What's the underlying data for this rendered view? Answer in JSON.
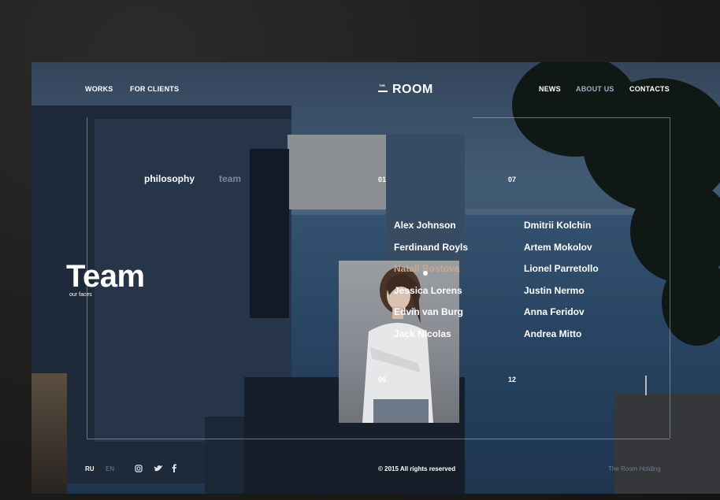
{
  "nav": {
    "left": [
      "WORKS",
      "FOR CLIENTS"
    ],
    "logo_small": "THE",
    "logo": "ROOM",
    "right": [
      {
        "label": "NEWS",
        "active": false
      },
      {
        "label": "ABOUT US",
        "active": true
      },
      {
        "label": "CONTACTS",
        "active": false
      }
    ]
  },
  "subnav": {
    "items": [
      "philosophy",
      "team"
    ],
    "active": "team"
  },
  "section": {
    "title": "Team",
    "subtitle": "our faces"
  },
  "pagination": {
    "top_left": "01",
    "top_right": "07",
    "bottom_left": "06",
    "bottom_right": "12"
  },
  "team": {
    "column1": [
      "Alex Johnson",
      "Ferdinand Royls",
      "Natali Rostova",
      "Jessica Lorens",
      "Edvin van Burg",
      "Jack Nicolas"
    ],
    "column2": [
      "Dmitrii Kolchin",
      "Artem Mokolov",
      "Lionel Parretollo",
      "Justin Nermo",
      "Anna Feridov",
      "Andrea Mitto"
    ],
    "highlighted": "Natali Rostova"
  },
  "footer": {
    "languages": [
      "RU",
      "EN"
    ],
    "social_icons": [
      "instagram-icon",
      "twitter-icon",
      "facebook-icon"
    ],
    "copyright": "© 2015  All rights reserved",
    "credit": "The Room Holding"
  },
  "colors": {
    "accent": "#c9a98a",
    "text": "#ffffff",
    "dim": "#9fb0c4"
  }
}
